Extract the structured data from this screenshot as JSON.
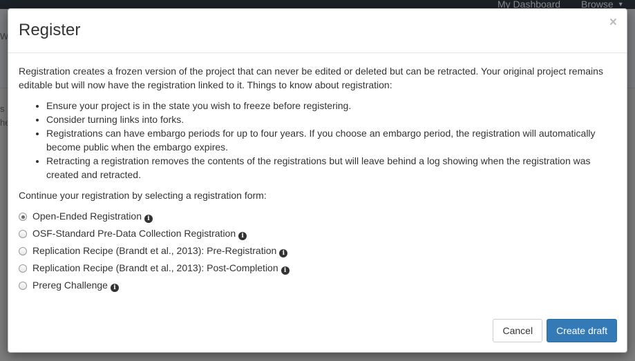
{
  "background": {
    "nav": {
      "dashboard": "My Dashboard",
      "browse": "Browse"
    },
    "fragments": [
      "W",
      "s p",
      "he"
    ]
  },
  "modal": {
    "title": "Register",
    "close_symbol": "×",
    "intro": "Registration creates a frozen version of the project that can never be edited or deleted but can be retracted. Your original project remains editable but will now have the registration linked to it. Things to know about registration:",
    "bullets": [
      "Ensure your project is in the state you wish to freeze before registering.",
      "Consider turning links into forks.",
      "Registrations can have embargo periods for up to four years. If you choose an embargo period, the registration will automatically become public when the embargo expires.",
      "Retracting a registration removes the contents of the registrations but will leave behind a log showing when the registration was created and retracted."
    ],
    "continue_text": "Continue your registration by selecting a registration form:",
    "options": [
      {
        "label": "Open-Ended Registration",
        "selected": true
      },
      {
        "label": "OSF-Standard Pre-Data Collection Registration",
        "selected": false
      },
      {
        "label": "Replication Recipe (Brandt et al., 2013): Pre-Registration",
        "selected": false
      },
      {
        "label": "Replication Recipe (Brandt et al., 2013): Post-Completion",
        "selected": false
      },
      {
        "label": "Prereg Challenge",
        "selected": false
      }
    ],
    "info_glyph": "i",
    "cancel_label": "Cancel",
    "create_label": "Create draft"
  },
  "colors": {
    "primary": "#337ab7",
    "navbar": "#1c2128",
    "overlay": "#7d7d7d"
  }
}
